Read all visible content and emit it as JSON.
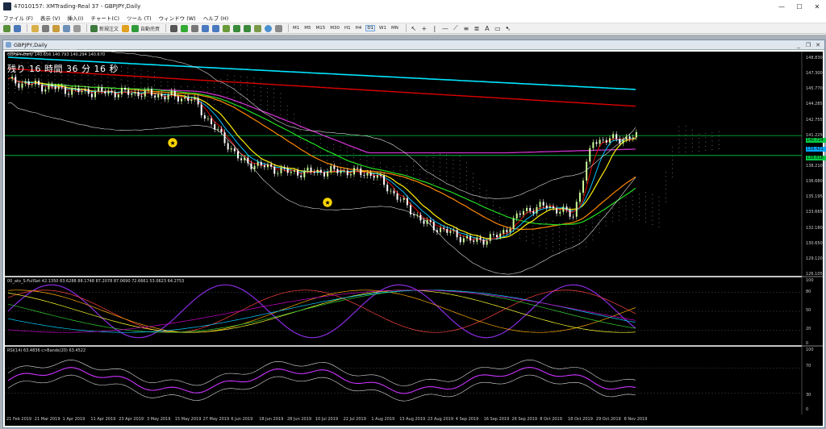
{
  "window": {
    "title": "47010157: XMTrading-Real 37 - GBPJPY,Daily",
    "minimize": "—",
    "maximize": "☐",
    "close": "✕"
  },
  "menu": [
    {
      "label": "ファイル (F)"
    },
    {
      "label": "表示 (V)"
    },
    {
      "label": "挿入(I)"
    },
    {
      "label": "チャート(C)"
    },
    {
      "label": "ツール (T)"
    },
    {
      "label": "ウィンドウ (W)"
    },
    {
      "label": "ヘルプ (H)"
    }
  ],
  "toolbar": {
    "new_order": "新規注文",
    "auto_trade": "自動売買",
    "timeframes": [
      "M1",
      "M5",
      "M15",
      "M30",
      "H1",
      "H4",
      "D1",
      "W1",
      "MN"
    ],
    "active_timeframe": "D1"
  },
  "chart_window": {
    "title": "GBPJPY,Daily"
  },
  "main_pane": {
    "ohlc": "GBPJPY,Daily  140.656 140.793 140.294 140.670",
    "countdown": "残り 16 時間 36 分 16 秒",
    "price_axis": [
      "148.830",
      "147.300",
      "145.770",
      "144.285",
      "142.755",
      "141.225",
      "139.230",
      "138.210",
      "136.680",
      "135.195",
      "133.665",
      "132.180",
      "130.650",
      "129.120",
      "126.105"
    ],
    "price_tags": [
      {
        "text": "140.724",
        "color": "#00cc44"
      },
      {
        "text": "139.421",
        "color": "#00aaff"
      },
      {
        "text": "138.618",
        "color": "#00cc44"
      }
    ]
  },
  "stoch_pane": {
    "label": "00_ato_S-FullSet 42.1350 83.6288 88.1748 87.2078 87.0690 72.6661 53.0623 64.2753",
    "axis": [
      "100",
      "80",
      "50",
      "20",
      "0"
    ]
  },
  "rsi_pane": {
    "label": "RSI(14) 63.4836  c>Bands(20) 63.4522",
    "axis": [
      "100",
      "70",
      "30",
      "0"
    ]
  },
  "date_axis": [
    "21 Feb 2019",
    "21 Mar 2019",
    "1 Apr 2019",
    "11 Apr 2019",
    "23 Apr 2019",
    "3 May 2019",
    "15 May 2019",
    "27 May 2019",
    "6 Jun 2019",
    "18 Jun 2019",
    "28 Jun 2019",
    "10 Jul 2019",
    "22 Jul 2019",
    "1 Aug 2019",
    "13 Aug 2019",
    "23 Aug 2019",
    "4 Sep 2019",
    "16 Sep 2019",
    "26 Sep 2019",
    "8 Oct 2019",
    "18 Oct 2019",
    "29 Oct 2019",
    "8 Nov 2019"
  ],
  "colors": {
    "chart_bg": "#000000",
    "bull_candle": "#ccff99",
    "bear_candle": "#ffffff",
    "ma_cyan": "#00e5ff",
    "ma_red": "#e00000",
    "ma_magenta": "#cc33cc",
    "ma_orange": "#ff8800",
    "ma_yellow": "#ffee00",
    "ma_green": "#22dd22",
    "bb": "#dddddd",
    "stoch_main": "#8a2be2",
    "rsi": "#cc33ff"
  }
}
